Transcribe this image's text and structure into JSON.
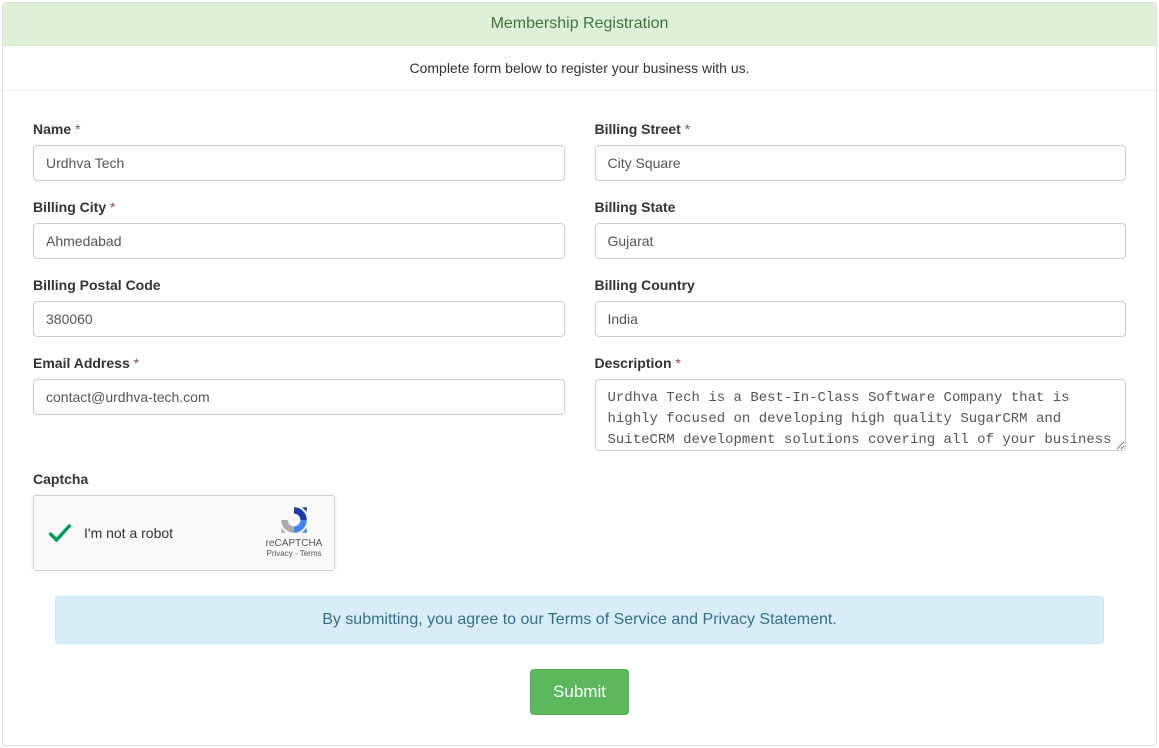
{
  "header": {
    "title": "Membership Registration",
    "subtitle": "Complete form below to register your business with us."
  },
  "form": {
    "name": {
      "label": "Name",
      "required": "*",
      "value": "Urdhva Tech"
    },
    "billing_street": {
      "label": "Billing Street",
      "required": "*",
      "value": "City Square"
    },
    "billing_city": {
      "label": "Billing City",
      "required": "*",
      "value": "Ahmedabad"
    },
    "billing_state": {
      "label": "Billing State",
      "value": "Gujarat"
    },
    "billing_postal_code": {
      "label": "Billing Postal Code",
      "value": "380060"
    },
    "billing_country": {
      "label": "Billing Country",
      "value": "India"
    },
    "email": {
      "label": "Email Address",
      "required": "*",
      "value": "contact@urdhva-tech.com"
    },
    "description": {
      "label": "Description",
      "required": "*",
      "value": "Urdhva Tech is a Best-In-Class Software Company that is highly focused on developing high quality SugarCRM and SuiteCRM development solutions covering all of your business needs with the entire responsibility of"
    }
  },
  "captcha": {
    "label": "Captcha",
    "text": "I'm not a robot",
    "brand": "reCAPTCHA",
    "links": "Privacy - Terms"
  },
  "agreement": "By submitting, you agree to our Terms of Service and Privacy Statement.",
  "submit": "Submit"
}
